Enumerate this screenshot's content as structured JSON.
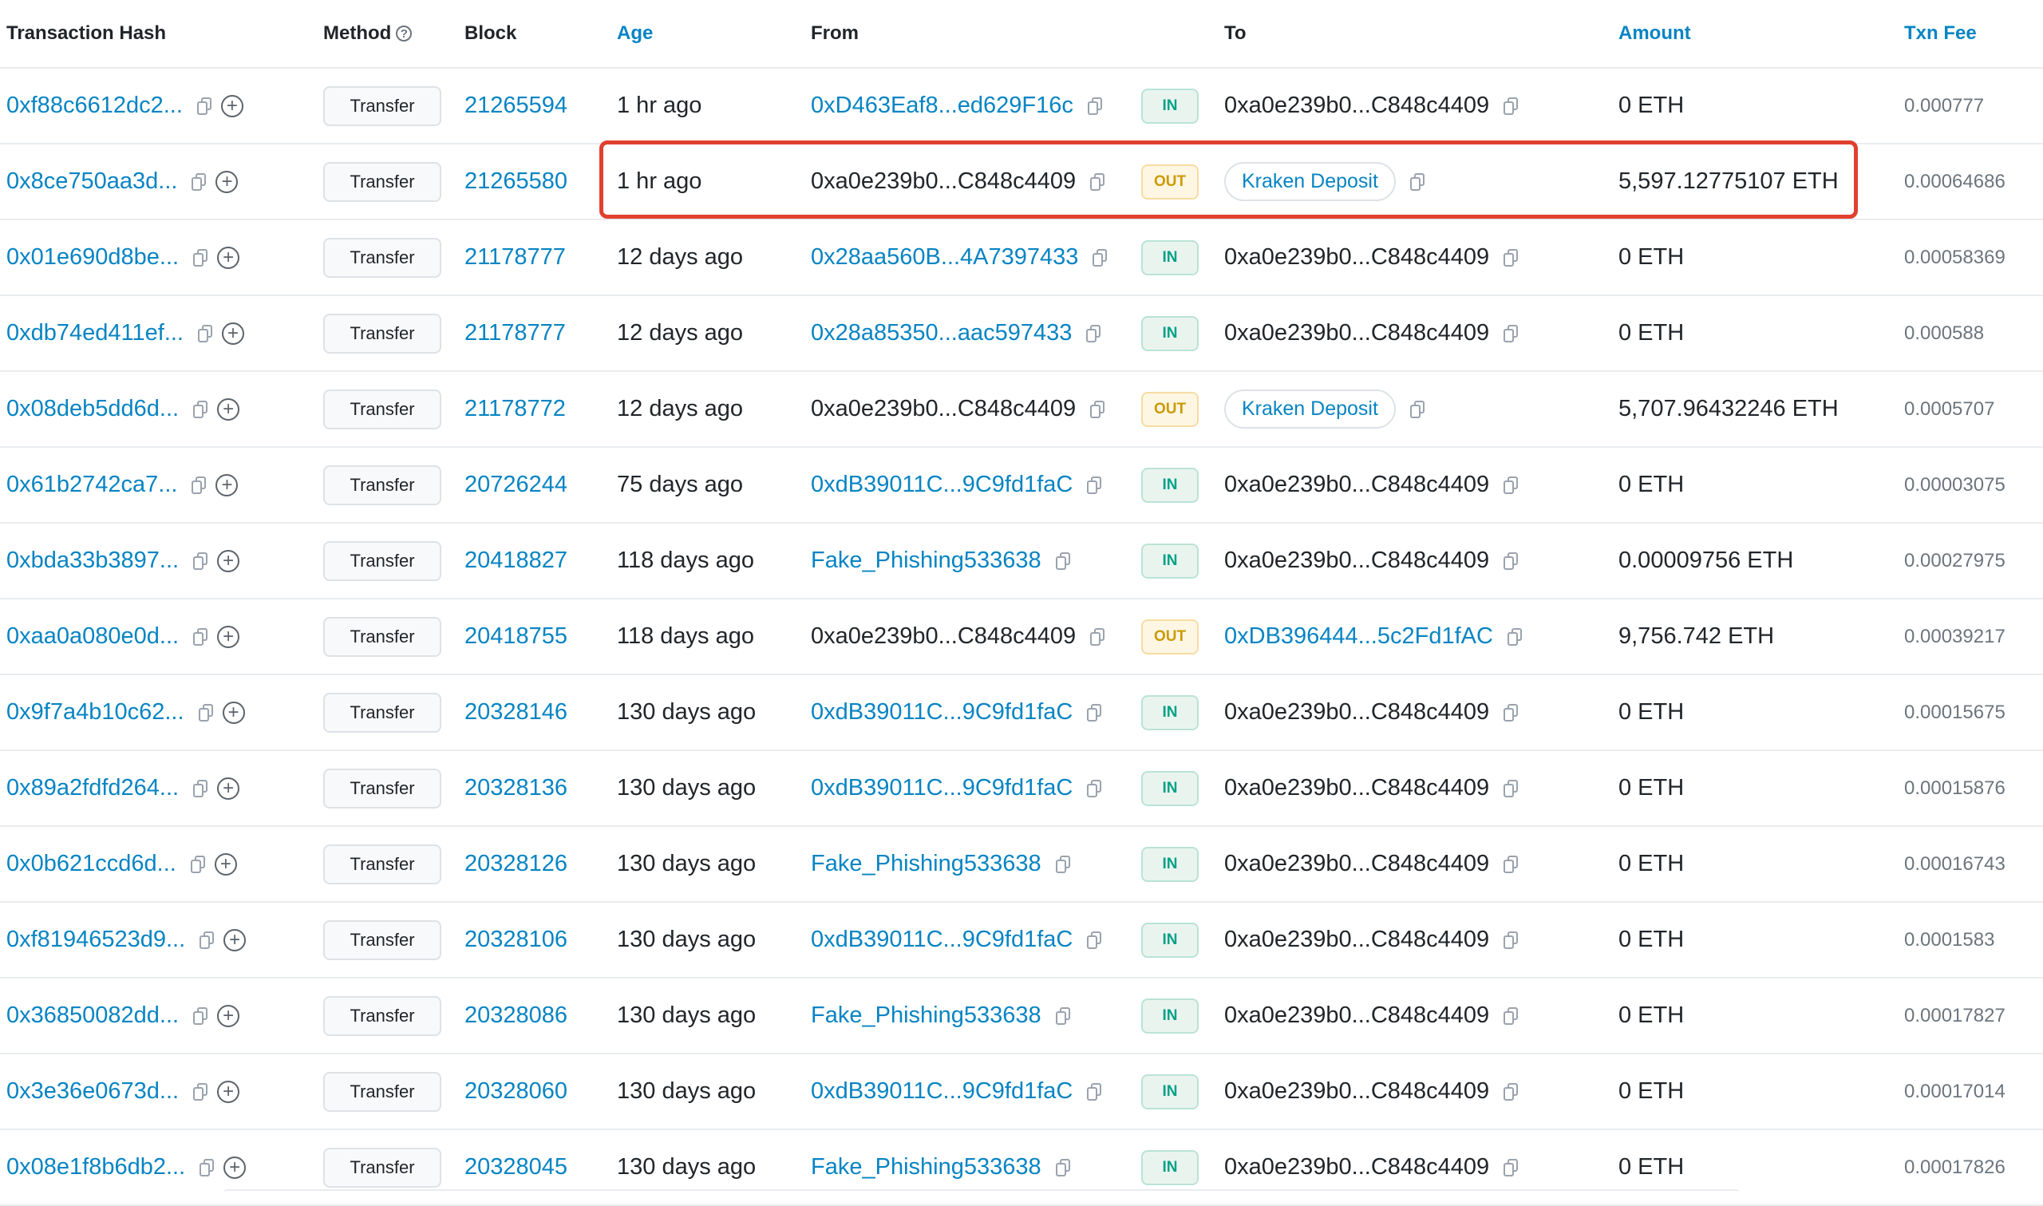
{
  "headers": {
    "hash": "Transaction Hash",
    "method": "Method",
    "method_help": "?",
    "block": "Block",
    "age": "Age",
    "from": "From",
    "to": "To",
    "amount": "Amount",
    "fee": "Txn Fee"
  },
  "plus_glyph": "+",
  "colors": {
    "link": "#0784c3",
    "in": "#00a186",
    "out": "#cc9a06",
    "highlight": "#e0402e"
  },
  "rows": [
    {
      "hash": "0xf88c6612dc2...",
      "method": "Transfer",
      "block": "21265594",
      "age": "1 hr ago",
      "from": "0xD463Eaf8...ed629F16c",
      "from_link": true,
      "dir": "IN",
      "to": "0xa0e239b0...C848c4409",
      "to_link": false,
      "to_tag": false,
      "amount": "0 ETH",
      "fee": "0.000777"
    },
    {
      "hash": "0x8ce750aa3d...",
      "method": "Transfer",
      "block": "21265580",
      "age": "1 hr ago",
      "from": "0xa0e239b0...C848c4409",
      "from_link": false,
      "dir": "OUT",
      "to": "Kraken Deposit",
      "to_link": true,
      "to_tag": true,
      "amount": "5,597.12775107 ETH",
      "fee": "0.00064686"
    },
    {
      "hash": "0x01e690d8be...",
      "method": "Transfer",
      "block": "21178777",
      "age": "12 days ago",
      "from": "0x28aa560B...4A7397433",
      "from_link": true,
      "dir": "IN",
      "to": "0xa0e239b0...C848c4409",
      "to_link": false,
      "to_tag": false,
      "amount": "0 ETH",
      "fee": "0.00058369"
    },
    {
      "hash": "0xdb74ed411ef...",
      "method": "Transfer",
      "block": "21178777",
      "age": "12 days ago",
      "from": "0x28a85350...aac597433",
      "from_link": true,
      "dir": "IN",
      "to": "0xa0e239b0...C848c4409",
      "to_link": false,
      "to_tag": false,
      "amount": "0 ETH",
      "fee": "0.000588"
    },
    {
      "hash": "0x08deb5dd6d...",
      "method": "Transfer",
      "block": "21178772",
      "age": "12 days ago",
      "from": "0xa0e239b0...C848c4409",
      "from_link": false,
      "dir": "OUT",
      "to": "Kraken Deposit",
      "to_link": true,
      "to_tag": true,
      "amount": "5,707.96432246 ETH",
      "fee": "0.0005707"
    },
    {
      "hash": "0x61b2742ca7...",
      "method": "Transfer",
      "block": "20726244",
      "age": "75 days ago",
      "from": "0xdB39011C...9C9fd1faC",
      "from_link": true,
      "dir": "IN",
      "to": "0xa0e239b0...C848c4409",
      "to_link": false,
      "to_tag": false,
      "amount": "0 ETH",
      "fee": "0.00003075"
    },
    {
      "hash": "0xbda33b3897...",
      "method": "Transfer",
      "block": "20418827",
      "age": "118 days ago",
      "from": "Fake_Phishing533638",
      "from_link": true,
      "dir": "IN",
      "to": "0xa0e239b0...C848c4409",
      "to_link": false,
      "to_tag": false,
      "amount": "0.00009756 ETH",
      "fee": "0.00027975"
    },
    {
      "hash": "0xaa0a080e0d...",
      "method": "Transfer",
      "block": "20418755",
      "age": "118 days ago",
      "from": "0xa0e239b0...C848c4409",
      "from_link": false,
      "dir": "OUT",
      "to": "0xDB396444...5c2Fd1fAC",
      "to_link": true,
      "to_tag": false,
      "amount": "9,756.742 ETH",
      "fee": "0.00039217"
    },
    {
      "hash": "0x9f7a4b10c62...",
      "method": "Transfer",
      "block": "20328146",
      "age": "130 days ago",
      "from": "0xdB39011C...9C9fd1faC",
      "from_link": true,
      "dir": "IN",
      "to": "0xa0e239b0...C848c4409",
      "to_link": false,
      "to_tag": false,
      "amount": "0 ETH",
      "fee": "0.00015675"
    },
    {
      "hash": "0x89a2fdfd264...",
      "method": "Transfer",
      "block": "20328136",
      "age": "130 days ago",
      "from": "0xdB39011C...9C9fd1faC",
      "from_link": true,
      "dir": "IN",
      "to": "0xa0e239b0...C848c4409",
      "to_link": false,
      "to_tag": false,
      "amount": "0 ETH",
      "fee": "0.00015876"
    },
    {
      "hash": "0x0b621ccd6d...",
      "method": "Transfer",
      "block": "20328126",
      "age": "130 days ago",
      "from": "Fake_Phishing533638",
      "from_link": true,
      "dir": "IN",
      "to": "0xa0e239b0...C848c4409",
      "to_link": false,
      "to_tag": false,
      "amount": "0 ETH",
      "fee": "0.00016743"
    },
    {
      "hash": "0xf81946523d9...",
      "method": "Transfer",
      "block": "20328106",
      "age": "130 days ago",
      "from": "0xdB39011C...9C9fd1faC",
      "from_link": true,
      "dir": "IN",
      "to": "0xa0e239b0...C848c4409",
      "to_link": false,
      "to_tag": false,
      "amount": "0 ETH",
      "fee": "0.0001583"
    },
    {
      "hash": "0x36850082dd...",
      "method": "Transfer",
      "block": "20328086",
      "age": "130 days ago",
      "from": "Fake_Phishing533638",
      "from_link": true,
      "dir": "IN",
      "to": "0xa0e239b0...C848c4409",
      "to_link": false,
      "to_tag": false,
      "amount": "0 ETH",
      "fee": "0.00017827"
    },
    {
      "hash": "0x3e36e0673d...",
      "method": "Transfer",
      "block": "20328060",
      "age": "130 days ago",
      "from": "0xdB39011C...9C9fd1faC",
      "from_link": true,
      "dir": "IN",
      "to": "0xa0e239b0...C848c4409",
      "to_link": false,
      "to_tag": false,
      "amount": "0 ETH",
      "fee": "0.00017014"
    },
    {
      "hash": "0x08e1f8b6db2...",
      "method": "Transfer",
      "block": "20328045",
      "age": "130 days ago",
      "from": "Fake_Phishing533638",
      "from_link": true,
      "dir": "IN",
      "to": "0xa0e239b0...C848c4409",
      "to_link": false,
      "to_tag": false,
      "amount": "0 ETH",
      "fee": "0.00017826"
    }
  ]
}
